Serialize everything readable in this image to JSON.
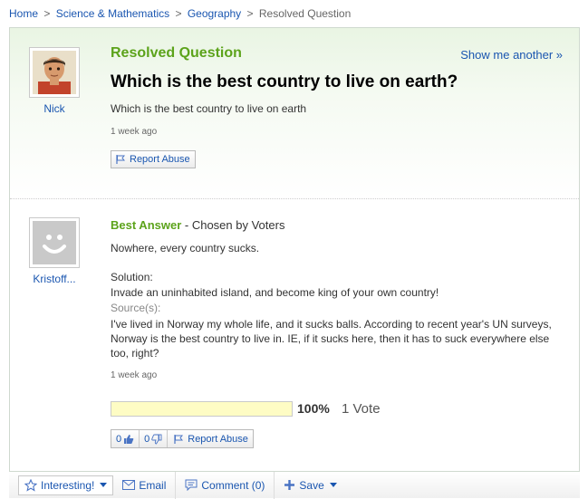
{
  "breadcrumb": {
    "items": [
      "Home",
      "Science & Mathematics",
      "Geography"
    ],
    "separator": ">",
    "current": "Resolved Question"
  },
  "question": {
    "status": "Resolved Question",
    "show_another": "Show me another »",
    "title": "Which is the best country to live on earth?",
    "body": "Which is the best country to live on earth",
    "time": "1 week ago",
    "asker": "Nick",
    "report_label": "Report Abuse"
  },
  "answer": {
    "best_label": "Best Answer",
    "chosen_by": " - Chosen by Voters",
    "text": "Nowhere, every country sucks.",
    "solution_label": "Solution:",
    "solution_text": "Invade an uninhabited island, and become king of your own country!",
    "sources_label": "Source(s):",
    "sources_text": "I've lived in Norway my whole life, and it sucks balls. According to recent year's UN surveys, Norway is the best country to live in. IE, if it sucks here, then it has to suck everywhere else too, right?",
    "time": "1 week ago",
    "answerer": "Kristoff...",
    "vote_percent": "100%",
    "vote_fraction": 1.0,
    "vote_count": "1 Vote",
    "thumbs_up_count": "0",
    "thumbs_down_count": "0",
    "report_label": "Report Abuse"
  },
  "toolbar": {
    "interesting": "Interesting!",
    "email": "Email",
    "comment": "Comment (0)",
    "save": "Save"
  },
  "colors": {
    "link": "#1a56b0",
    "accent_green": "#5ca31b",
    "vote_bar": "#fefcc4"
  },
  "icons": [
    "flag-icon",
    "thumbs-up-icon",
    "thumbs-down-icon",
    "star-icon",
    "envelope-icon",
    "comment-icon",
    "plus-icon",
    "caret-down-icon"
  ]
}
